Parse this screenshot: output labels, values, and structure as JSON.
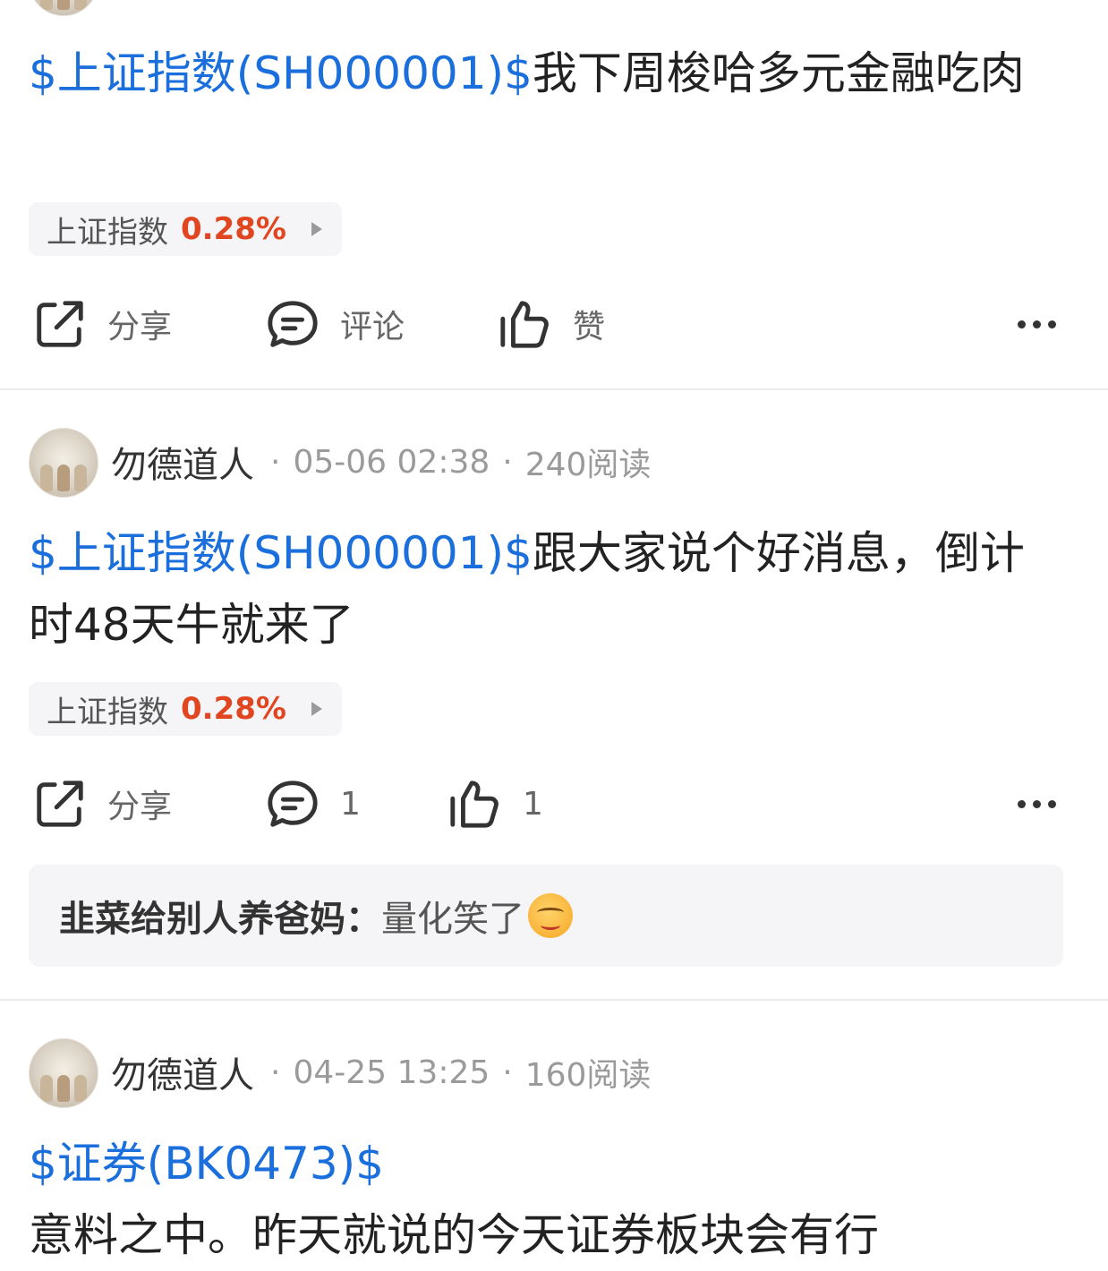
{
  "post1": {
    "tag": "$上证指数(SH000001)$",
    "text": "我下周梭哈多元金融吃肉",
    "chip": {
      "name": "上证指数",
      "pct": "0.28%"
    },
    "actions": {
      "share": "分享",
      "comment": "评论",
      "like": "赞"
    }
  },
  "post2": {
    "author": "勿德道人",
    "time": "05-06 02:38",
    "reads": "240阅读",
    "tag": "$上证指数(SH000001)$",
    "text": "跟大家说个好消息，倒计时48天牛就来了",
    "chip": {
      "name": "上证指数",
      "pct": "0.28%"
    },
    "actions": {
      "share": "分享",
      "comment": "1",
      "like": "1"
    },
    "top_comment": {
      "user": "韭菜给别人养爸妈：",
      "text": "量化笑了"
    }
  },
  "post3": {
    "author": "勿德道人",
    "time": "04-25 13:25",
    "reads": "160阅读",
    "tag": "$证券(BK0473)$",
    "text": "意料之中。昨天就说的今天证券板块会有行"
  },
  "separator": "·",
  "colors": {
    "link": "#1a6fdc",
    "up": "#e0461f",
    "chip_bg": "#f5f5f7"
  }
}
